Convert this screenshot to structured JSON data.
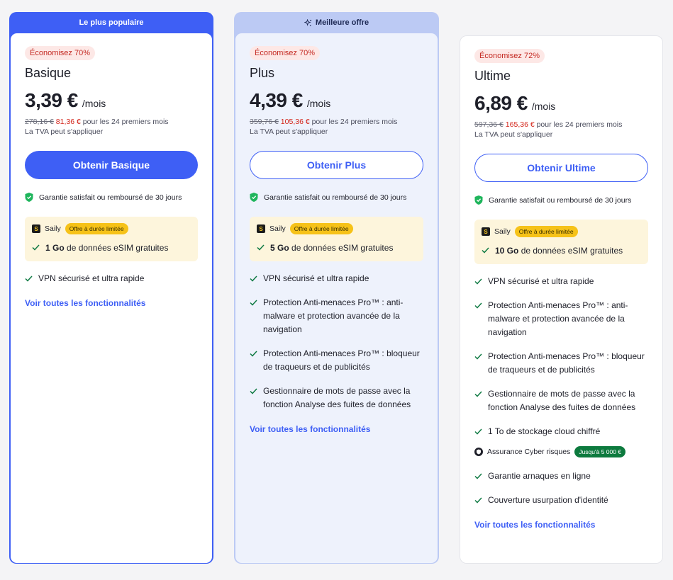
{
  "colors": {
    "brand": "#3e5ff5",
    "save_red": "#c42a23",
    "check_green": "#16a34a",
    "saily_yellow": "#f6c218"
  },
  "plans": [
    {
      "banner": "Le plus populaire",
      "save": "Économisez 70%",
      "name": "Basique",
      "price": "3,39 €",
      "per": "/mois",
      "old_price": "278,16 €",
      "new_total": "81,36 €",
      "period_note": "pour les 24 premiers mois",
      "vat": "La TVA peut s'appliquer",
      "cta": "Obtenir Basique",
      "guarantee": "Garantie satisfait ou remboursé de 30 jours",
      "saily": {
        "brand": "Saily",
        "badge": "Offre à durée limitée",
        "data_amount": "1 Go",
        "data_text": "de données eSIM gratuites"
      },
      "features": [
        "VPN sécurisé et ultra rapide"
      ],
      "see_all": "Voir toutes les fonctionnalités"
    },
    {
      "banner": "Meilleure offre",
      "save": "Économisez 70%",
      "name": "Plus",
      "price": "4,39 €",
      "per": "/mois",
      "old_price": "359,76 €",
      "new_total": "105,36 €",
      "period_note": "pour les 24 premiers mois",
      "vat": "La TVA peut s'appliquer",
      "cta": "Obtenir Plus",
      "guarantee": "Garantie satisfait ou remboursé de 30 jours",
      "saily": {
        "brand": "Saily",
        "badge": "Offre à durée limitée",
        "data_amount": "5 Go",
        "data_text": "de données eSIM gratuites"
      },
      "features": [
        "VPN sécurisé et ultra rapide",
        "Protection Anti-menaces Pro™ : anti-malware et protection avancée de la navigation",
        "Protection Anti-menaces Pro™ : bloqueur de traqueurs et de publicités",
        "Gestionnaire de mots de passe avec la fonction Analyse des fuites de données"
      ],
      "see_all": "Voir toutes les fonctionnalités"
    },
    {
      "save": "Économisez 72%",
      "name": "Ultime",
      "price": "6,89 €",
      "per": "/mois",
      "old_price": "597,36 €",
      "new_total": "165,36 €",
      "period_note": "pour les 24 premiers mois",
      "vat": "La TVA peut s'appliquer",
      "cta": "Obtenir Ultime",
      "guarantee": "Garantie satisfait ou remboursé de 30 jours",
      "saily": {
        "brand": "Saily",
        "badge": "Offre à durée limitée",
        "data_amount": "10 Go",
        "data_text": "de données eSIM gratuites"
      },
      "features": [
        "VPN sécurisé et ultra rapide",
        "Protection Anti-menaces Pro™ : anti-malware et protection avancée de la navigation",
        "Protection Anti-menaces Pro™ : bloqueur de traqueurs et de publicités",
        "Gestionnaire de mots de passe avec la fonction Analyse des fuites de données",
        "1 To de stockage cloud chiffré"
      ],
      "cyber": {
        "label": "Assurance Cyber risques",
        "badge": "Jusqu'à 5 000 €"
      },
      "features_after": [
        "Garantie arnaques en ligne",
        "Couverture usurpation d'identité"
      ],
      "see_all": "Voir toutes les fonctionnalités"
    }
  ]
}
